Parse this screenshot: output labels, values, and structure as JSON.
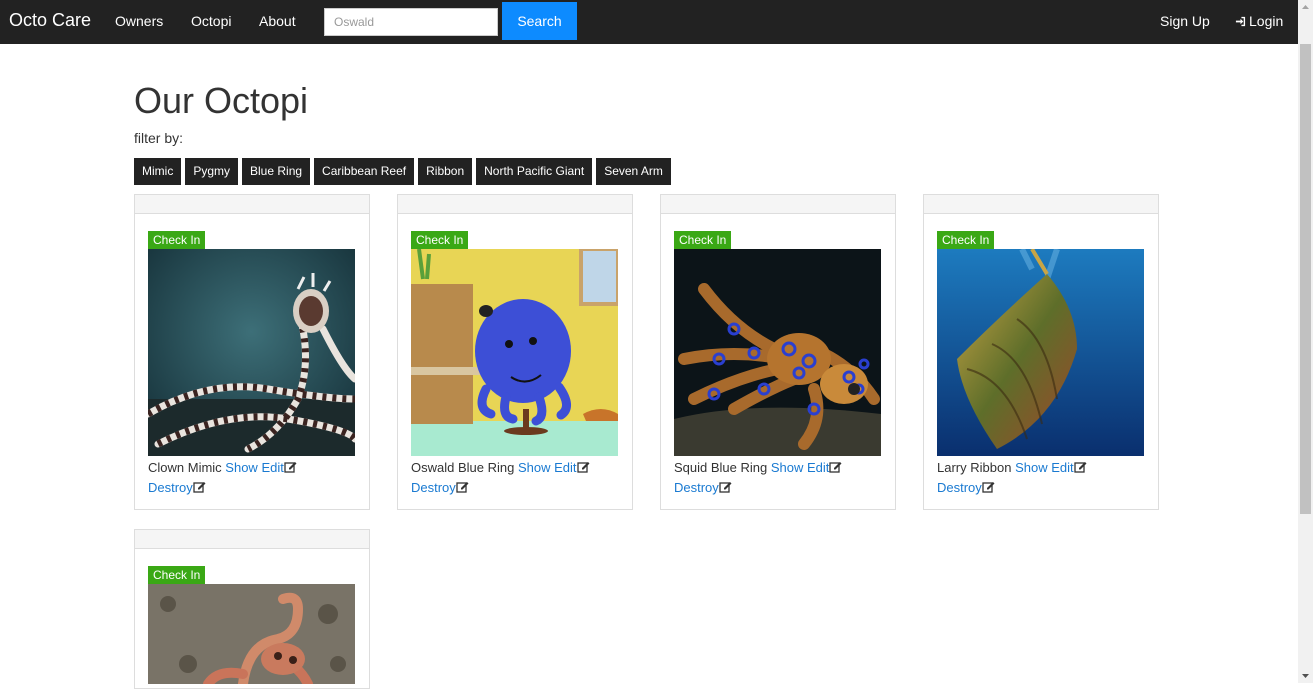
{
  "navbar": {
    "brand": "Octo Care",
    "links": [
      "Owners",
      "Octopi",
      "About"
    ],
    "search_value": "Oswald",
    "search_button": "Search",
    "signup": "Sign Up",
    "login": "Login"
  },
  "page": {
    "title": "Our Octopi",
    "filter_label": "filter by:",
    "filters": [
      "Mimic",
      "Pygmy",
      "Blue Ring",
      "Caribbean Reef",
      "Ribbon",
      "North Pacific Giant",
      "Seven Arm"
    ]
  },
  "cards": [
    {
      "name": "Clown Mimic",
      "checkin": "Check In",
      "show": "Show",
      "edit": "Edit",
      "destroy": "Destroy",
      "image": "mimic-octopus-photo"
    },
    {
      "name": "Oswald Blue Ring",
      "checkin": "Check In",
      "show": "Show",
      "edit": "Edit",
      "destroy": "Destroy",
      "image": "cartoon-octopus-photo"
    },
    {
      "name": "Squid Blue Ring",
      "checkin": "Check In",
      "show": "Show",
      "edit": "Edit",
      "destroy": "Destroy",
      "image": "blue-ring-octopus-photo"
    },
    {
      "name": "Larry Ribbon",
      "checkin": "Check In",
      "show": "Show",
      "edit": "Edit",
      "destroy": "Destroy",
      "image": "ribbon-octopus-photo"
    },
    {
      "name": "",
      "checkin": "Check In",
      "show": "",
      "edit": "",
      "destroy": "",
      "image": "reef-octopus-photo"
    }
  ],
  "colors": {
    "navbar": "#222222",
    "search_button": "#0d8bff",
    "checkin": "#3aa815",
    "link": "#1a7ad1"
  }
}
